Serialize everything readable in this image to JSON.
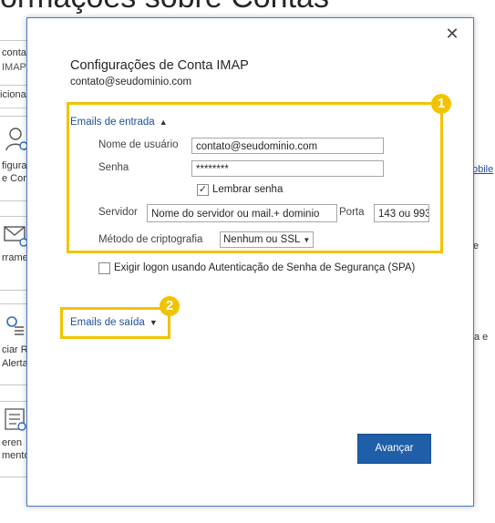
{
  "background": {
    "title": "ormações sobre Contas",
    "account_frag_1": "conta",
    "account_frag_2": "IMAP",
    "add_account_frag": "icional",
    "configure_frag_1": "figura",
    "configure_frag_2": "e Cont",
    "mobile_link": "obile",
    "tools_frag": "rrame",
    "tools_frag_right": "e",
    "rules_frag_1": "ciar R",
    "rules_frag_2": "Alerta",
    "rules_frag_right": "a e",
    "manage_frag_1": "eren",
    "manage_frag_2": "mento"
  },
  "dialog": {
    "title": "Configurações de Conta IMAP",
    "account": "contato@seudominio.com",
    "close_icon": "close-icon",
    "incoming": {
      "toggle_label": "Emails de entrada",
      "expanded_icon": "chevron-up-icon",
      "username_label": "Nome de usuário",
      "username_value": "contato@seudominio.com",
      "password_label": "Senha",
      "password_value": "********",
      "remember_label": "Lembrar senha",
      "remember_checked": true,
      "server_label": "Servidor",
      "server_value": "Nome do servidor ou mail.+ dominio",
      "port_label": "Porta",
      "port_value": "143 ou 993",
      "encryption_label": "Método de criptografia",
      "encryption_value": "Nenhum ou SSL"
    },
    "spa_label": "Exigir logon usando Autenticação de Senha de Segurança (SPA)",
    "spa_checked": false,
    "outgoing": {
      "toggle_label": "Emails de saída",
      "collapsed_icon": "chevron-down-icon"
    },
    "next_button": "Avançar"
  },
  "annotations": {
    "badge_1": "1",
    "badge_2": "2",
    "color": "#f1c300"
  },
  "colors": {
    "accent": "#1f5ea8",
    "link": "#1f4e9b",
    "dialog_border": "#4a79c4"
  }
}
